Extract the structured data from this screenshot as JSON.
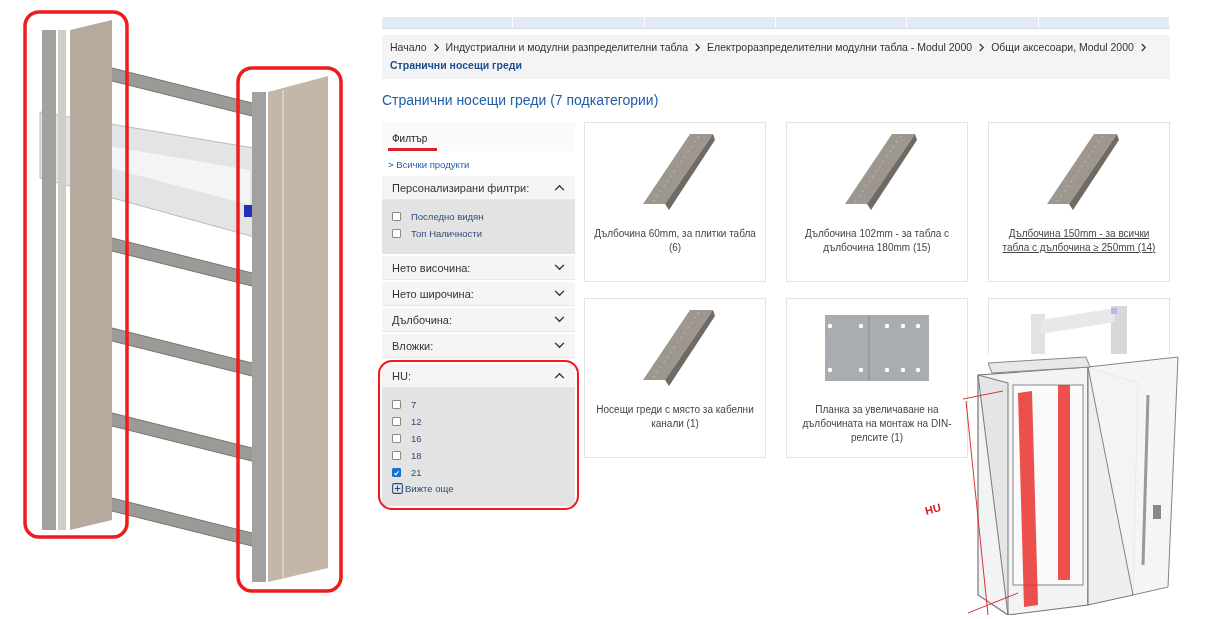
{
  "breadcrumb": [
    {
      "label": "Начало",
      "current": false
    },
    {
      "label": "Индустриални и модулни разпределителни табла",
      "current": false
    },
    {
      "label": "Електроразпределителни модулни табла - Modul 2000",
      "current": false
    },
    {
      "label": "Общи аксесоари, Modul 2000",
      "current": false
    },
    {
      "label": "Странични носещи греди",
      "current": true
    }
  ],
  "heading": "Странични носещи греди (7 подкатегории)",
  "filter": {
    "tab": "Филтър",
    "all_products_link": "> Всички продукти",
    "groups": [
      {
        "title": "Персонализирани филтри:",
        "expanded": true,
        "highlighted": false,
        "options": [
          {
            "label": "Последно видян",
            "checked": false
          },
          {
            "label": "Топ Наличности",
            "checked": false
          }
        ]
      },
      {
        "title": "Нето височина:",
        "expanded": false,
        "highlighted": false
      },
      {
        "title": "Нето широчина:",
        "expanded": false,
        "highlighted": false
      },
      {
        "title": "Дълбочина:",
        "expanded": false,
        "highlighted": false
      },
      {
        "title": "Вложки:",
        "expanded": false,
        "highlighted": false
      },
      {
        "title": "HU:",
        "expanded": true,
        "highlighted": true,
        "options": [
          {
            "label": "7",
            "checked": false
          },
          {
            "label": "12",
            "checked": false
          },
          {
            "label": "16",
            "checked": false
          },
          {
            "label": "18",
            "checked": false
          },
          {
            "label": "21",
            "checked": true
          }
        ],
        "more_link": "Вижте още"
      }
    ]
  },
  "categories": [
    {
      "kind": "rail",
      "caption": "Дълбочина 60mm, за плитки табла (6)",
      "hovered": false
    },
    {
      "kind": "rail",
      "caption": "Дълбочина 102mm - за табла с дълбочина 180mm (15)",
      "hovered": false
    },
    {
      "kind": "rail",
      "caption": "Дълбочина 150mm - за всички табла с дълбочина ≥ 250mm (14)",
      "hovered": true
    },
    {
      "kind": "rail",
      "caption": "Носещи греди с място за кабелни канали (1)",
      "hovered": false
    },
    {
      "kind": "plate",
      "caption": "Планка за увеличаване на дълбочината на монтаж на DIN-релсите (1)",
      "hovered": false
    },
    {
      "kind": "rack"
    }
  ],
  "overlay": {
    "dimension_label": "HU"
  }
}
